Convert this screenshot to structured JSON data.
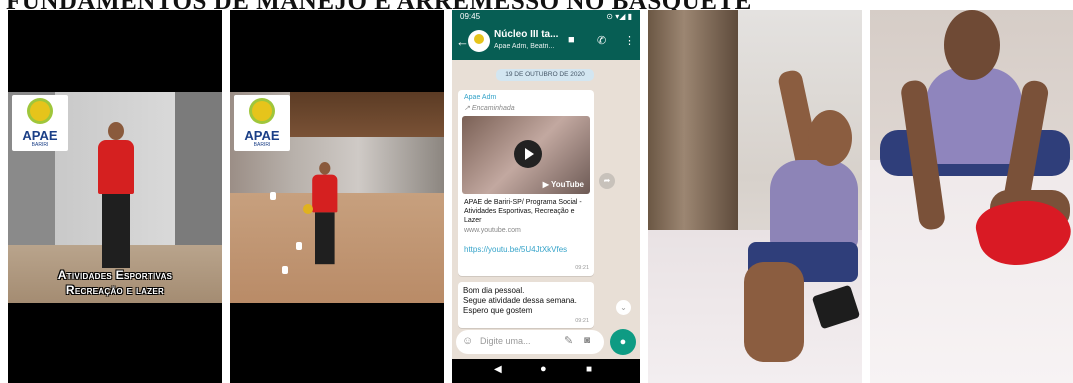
{
  "page": {
    "title": "FUNDAMENTOS DE MANEJO E ARREMESSO NO BASQUETE"
  },
  "panel1": {
    "logo_text": "APAE",
    "logo_sub": "BARIRI",
    "caption_line1": "Atividades Esportivas",
    "caption_line2": "Recreação e lazer"
  },
  "panel2": {
    "logo_text": "APAE",
    "logo_sub": "BARIRI"
  },
  "whatsapp": {
    "status_time": "09:45",
    "status_icons": "⊙ ▾◢ ▮",
    "group_name": "Núcleo III ta...",
    "group_sub": "Apae Adm, Beatri...",
    "date_chip": "19 DE OUTUBRO DE 2020",
    "message1": {
      "sender": "Apae Adm",
      "forwarded": "Encaminhada",
      "video_brand": "YouTube",
      "link_title": "APAE de Bariri-SP/ Programa Social - Atividades Esportivas, Recreação e Lazer",
      "link_domain": "www.youtube.com",
      "link_url": "https://youtu.be/5U4JtXkVfes",
      "time": "09:21"
    },
    "message2": {
      "body_line1": "Bom dia pessoal.",
      "body_line2": "Segue atividade dessa semana.",
      "body_line3": "Espero que gostem",
      "time": "09:21"
    },
    "input_placeholder": "Digite uma...",
    "icons": {
      "back": "back-arrow-icon",
      "video_call": "video-camera-icon",
      "voice_call": "phone-icon",
      "menu": "more-vert-icon",
      "emoji": "emoji-icon",
      "attach": "paperclip-icon",
      "camera": "camera-icon",
      "mic": "microphone-icon"
    }
  },
  "colors": {
    "whatsapp_green": "#075e54",
    "accent_teal": "#0e9b83",
    "shirt_red": "#d52020",
    "shirt_purple": "#8d84b7"
  }
}
